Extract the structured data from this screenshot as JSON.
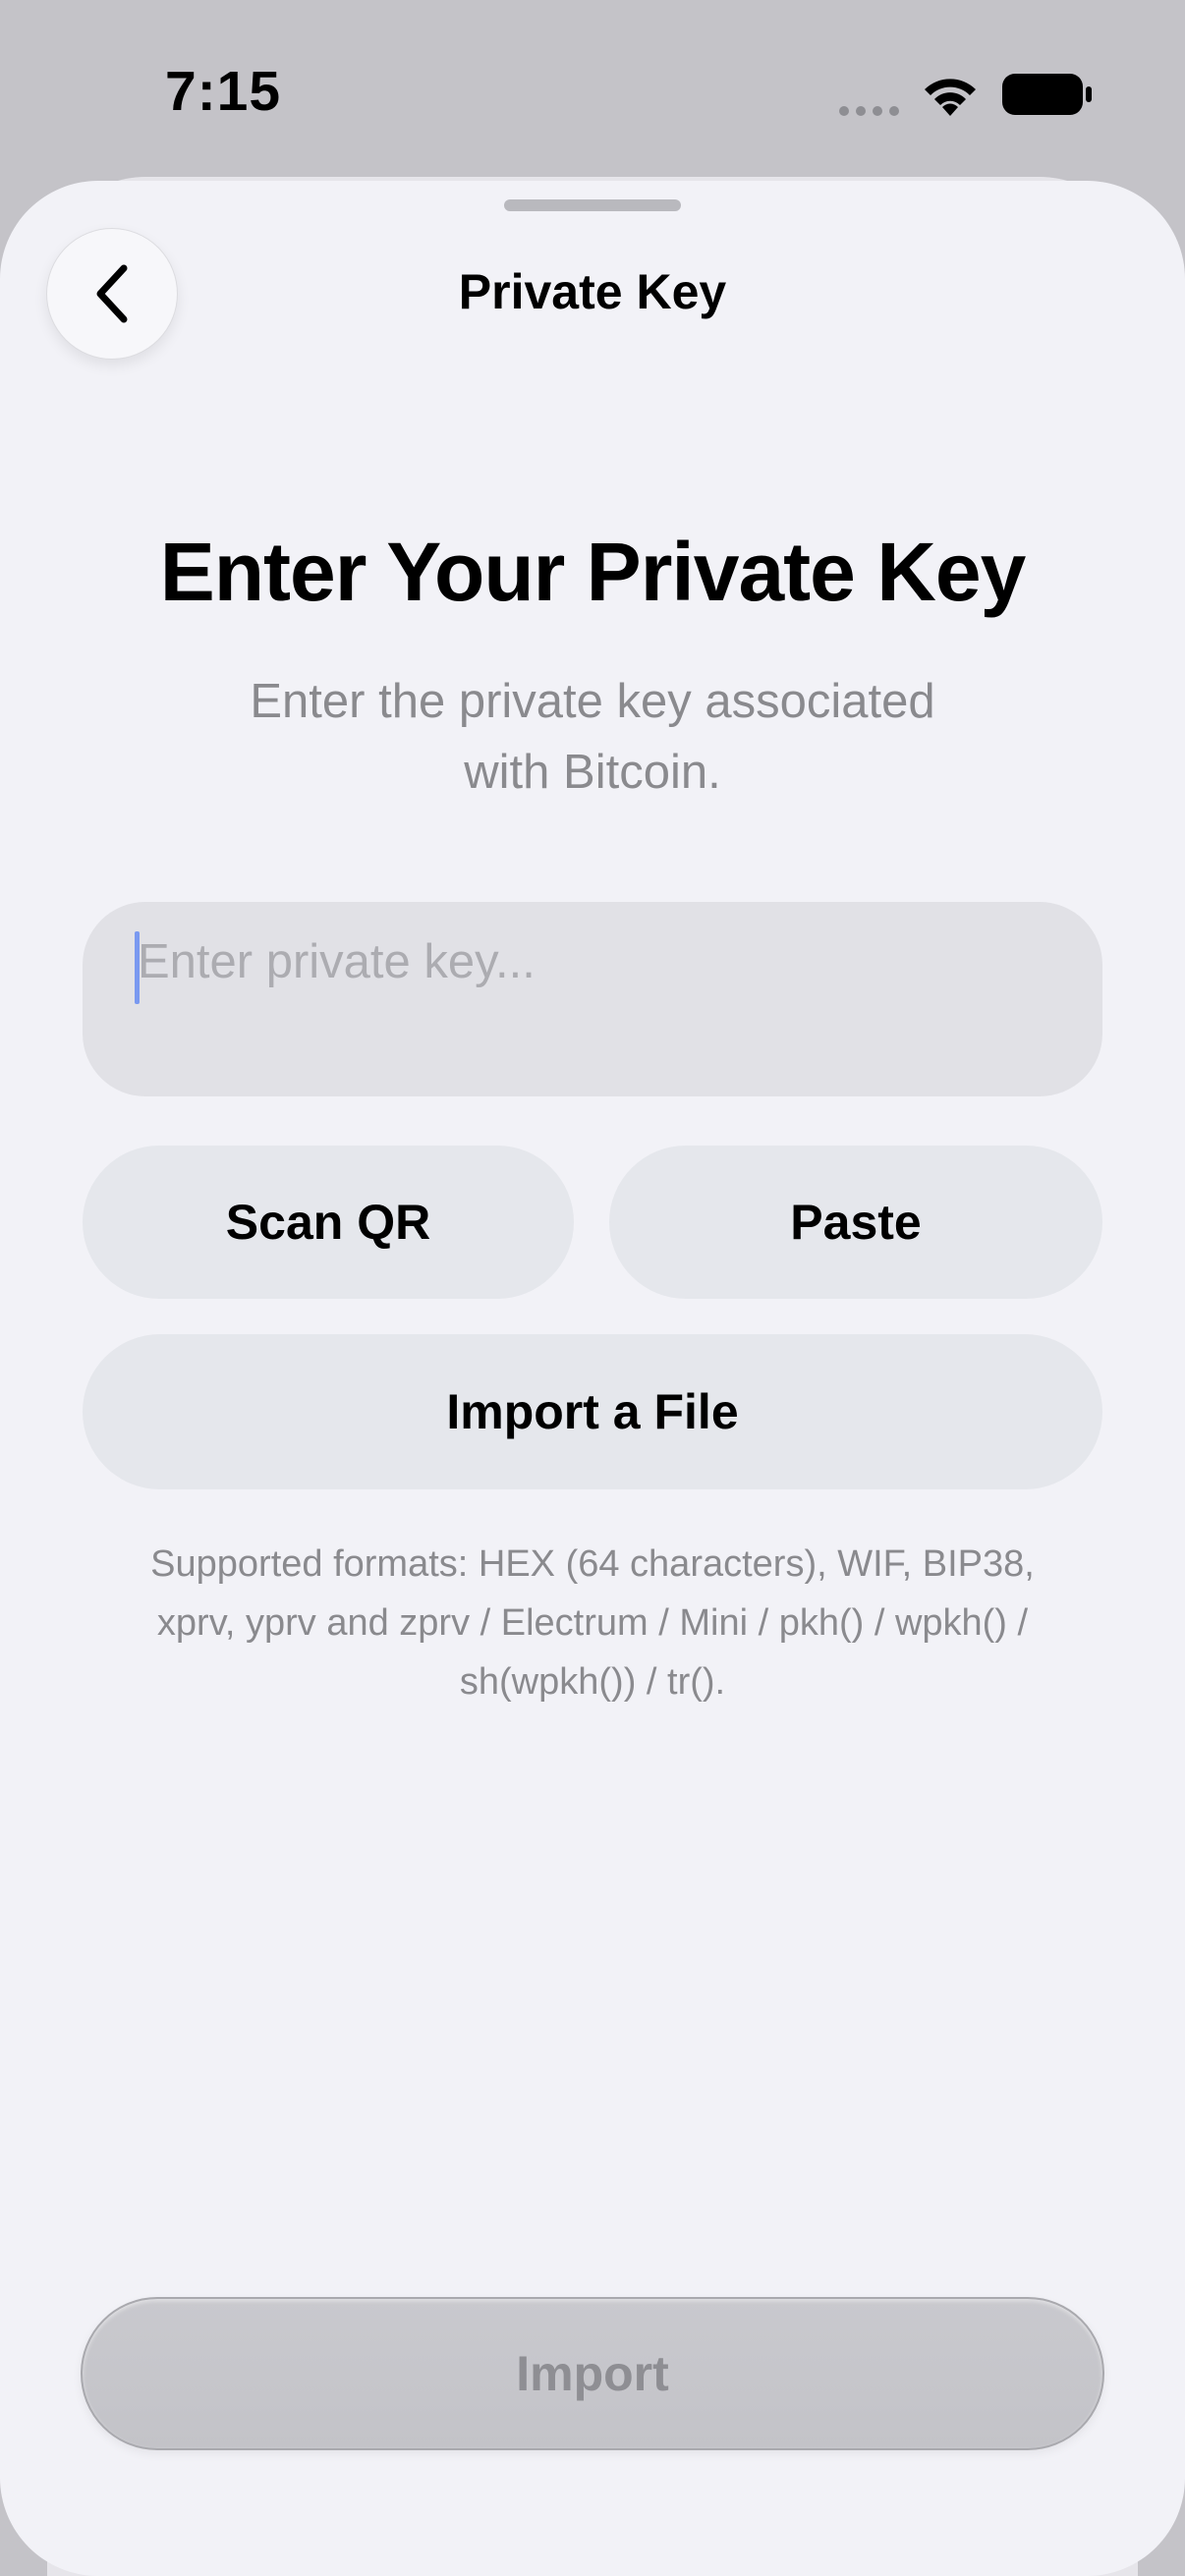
{
  "status_bar": {
    "time": "7:15",
    "icons": [
      "cellular-dots-icon",
      "wifi-icon",
      "battery-icon"
    ]
  },
  "nav": {
    "title": "Private Key",
    "back_icon": "chevron-left-icon"
  },
  "content": {
    "headline": "Enter Your Private Key",
    "subtitle_line1": "Enter the private key associated",
    "subtitle_line2": "with Bitcoin.",
    "key_input": {
      "value": "",
      "placeholder": "Enter private key..."
    },
    "buttons": {
      "scan_qr": "Scan QR",
      "paste": "Paste",
      "import_file": "Import a File"
    },
    "formats_line1": "Supported formats: HEX (64 characters), WIF, BIP38,",
    "formats_line2": "xprv, yprv and zprv / Electrum / Mini / pkh() / wpkh() /",
    "formats_line3": "sh(wpkh()) / tr()."
  },
  "footer": {
    "import_label": "Import",
    "import_enabled": false
  },
  "colors": {
    "sheet_background": "#f2f2f7",
    "input_background": "#e1e1e6",
    "pill_background": "#e5e7ec",
    "secondary_text": "#8a8a8e",
    "caret": "#7a99f0",
    "disabled_button": "#c6c6cb"
  }
}
